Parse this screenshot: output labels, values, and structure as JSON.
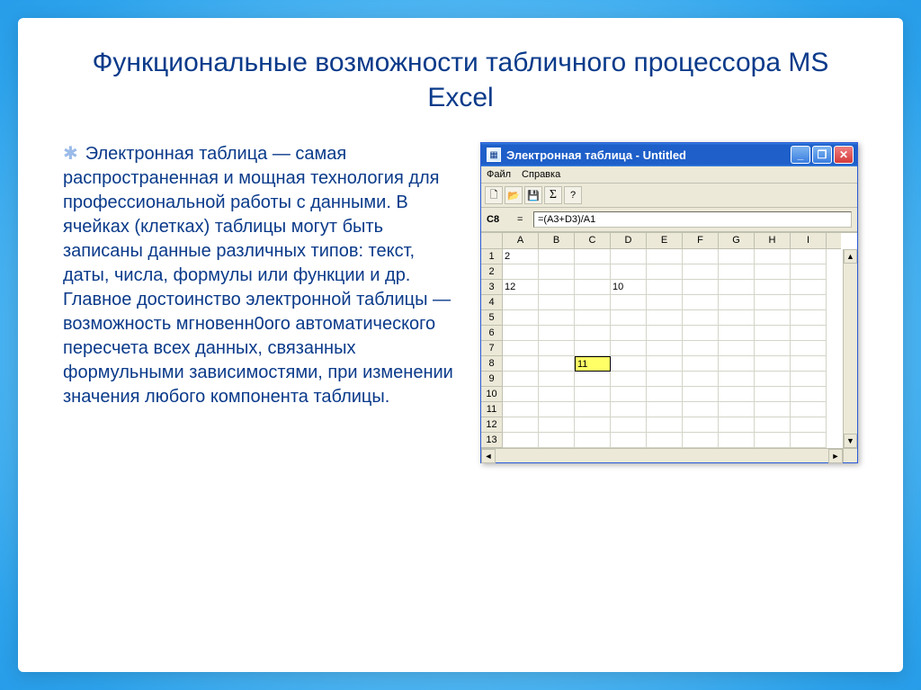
{
  "slide": {
    "title": "Функциональные возможности табличного процессора MS Excel",
    "body": "Электронная таблица — самая распространенная и мощная технология для профессиональной работы с данными. В ячейках (клетках) таблицы могут быть записаны данные различных типов: текст, даты, числа, формулы или функции и др. Главное достоинство электронной таблицы — возможность мгновенн0ого автоматического пересчета всех данных, связанных формульными зависимостями, при изменении значения любого компонента таблицы."
  },
  "window": {
    "title": "Электронная таблица - Untitled",
    "menu": {
      "file": "Файл",
      "help": "Справка"
    },
    "toolbar": {
      "new": "🗋",
      "open": "📂",
      "save": "💾",
      "sigma": "Σ",
      "help": "?"
    },
    "formula": {
      "cell_ref": "C8",
      "eq": "=",
      "value": "=(A3+D3)/A1"
    },
    "columns": [
      "A",
      "B",
      "C",
      "D",
      "E",
      "F",
      "G",
      "H",
      "I"
    ],
    "rows": [
      "1",
      "2",
      "3",
      "4",
      "5",
      "6",
      "7",
      "8",
      "9",
      "10",
      "11",
      "12",
      "13"
    ],
    "cells": {
      "r1_A": "2",
      "r3_A": "12",
      "r3_D": "10",
      "r8_C": "11"
    },
    "active_cell": "r8_C",
    "win_btns": {
      "min": "_",
      "max": "❐",
      "close": "✕"
    },
    "scroll": {
      "up": "▲",
      "down": "▼",
      "left": "◄",
      "right": "►"
    }
  }
}
